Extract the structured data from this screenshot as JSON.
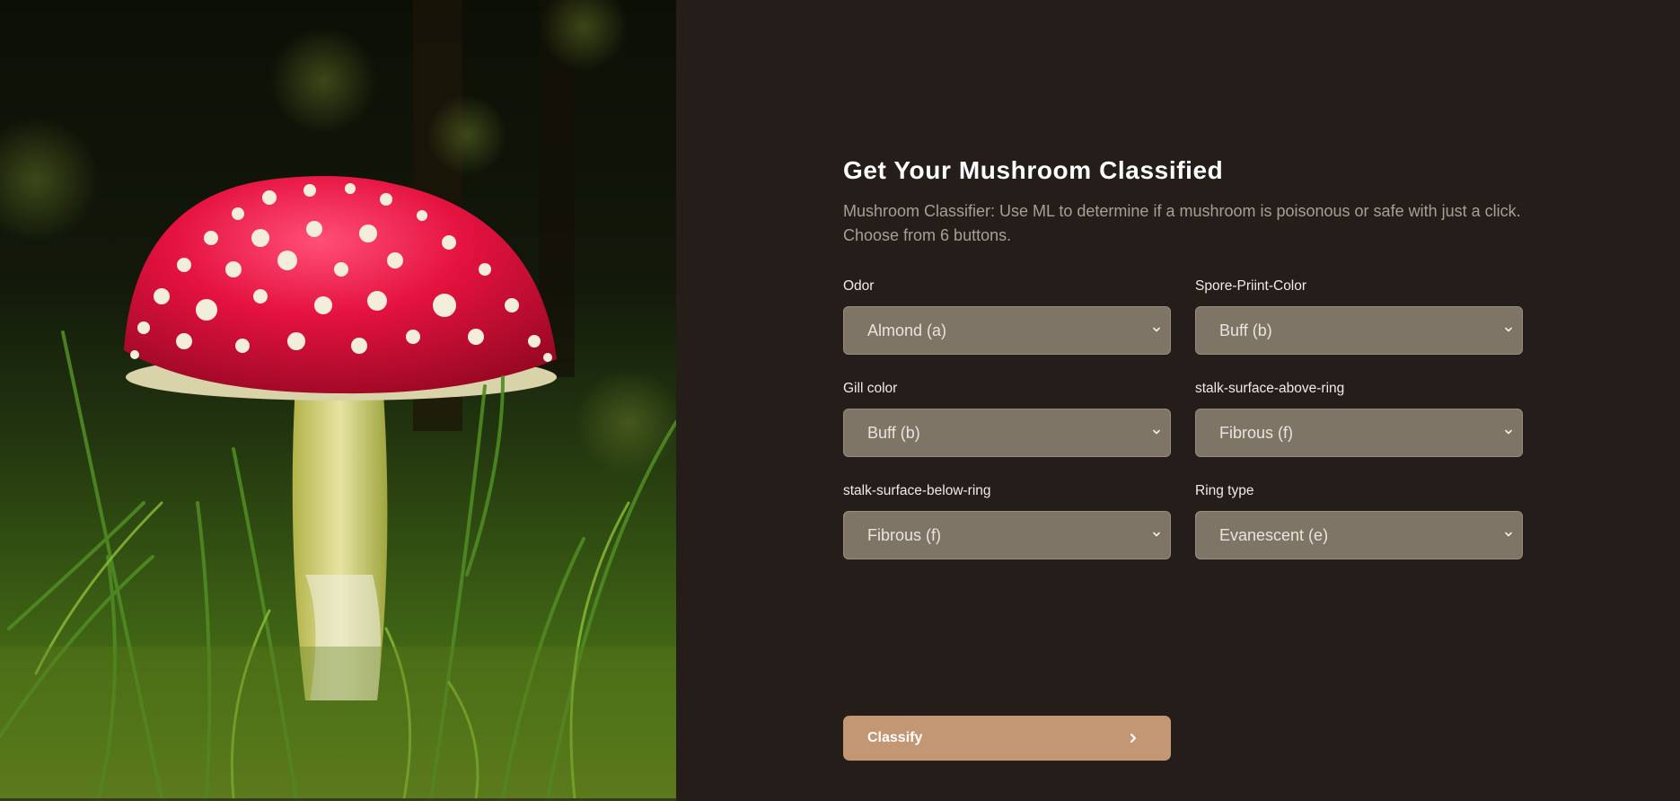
{
  "hero": {
    "image": "fly-agaric-mushroom-photo"
  },
  "form": {
    "title": "Get Your Mushroom Classified",
    "description": "Mushroom Classifier: Use ML to determine if a mushroom is poisonous or safe with just a click. Choose from 6 buttons.",
    "fields": [
      {
        "label": "Odor",
        "value": "Almond (a)"
      },
      {
        "label": "Spore-Priint-Color",
        "value": "Buff (b)"
      },
      {
        "label": "Gill color",
        "value": "Buff (b)"
      },
      {
        "label": "stalk-surface-above-ring",
        "value": "Fibrous (f)"
      },
      {
        "label": "stalk-surface-below-ring",
        "value": "Fibrous (f)"
      },
      {
        "label": "Ring type",
        "value": "Evanescent (e)"
      }
    ],
    "submit_label": "Classify",
    "icons": {
      "select": "chevron-down-icon",
      "submit": "chevron-right-icon"
    }
  },
  "colors": {
    "background": "#241d19",
    "select_bg": "#7f7567",
    "button_bg": "#c39774",
    "mushroom_cap": "#e0103a"
  }
}
